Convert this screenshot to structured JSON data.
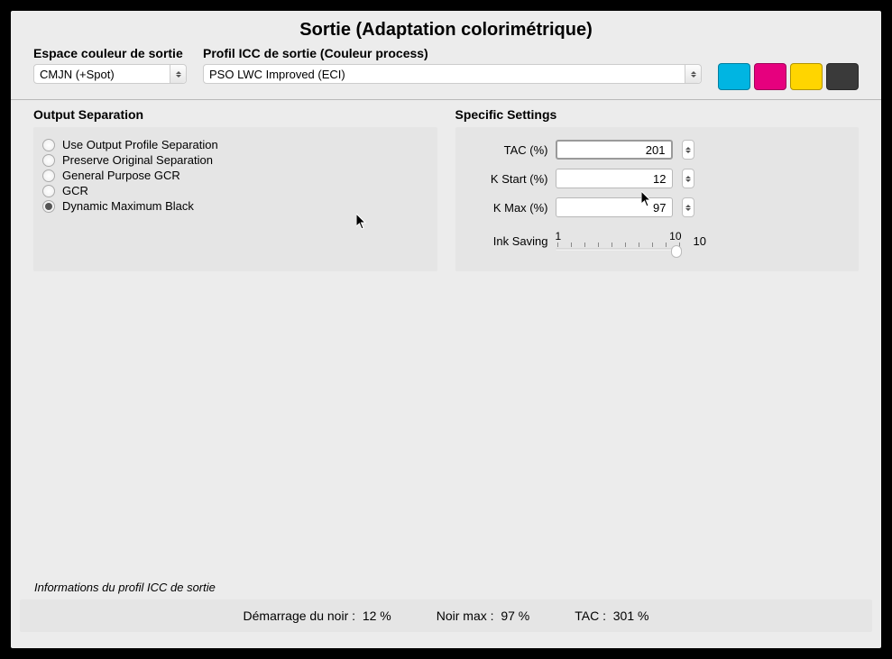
{
  "title": "Sortie (Adaptation colorimétrique)",
  "fields": {
    "ecs_label": "Espace couleur de sortie",
    "ecs_value": "CMJN (+Spot)",
    "icc_label": "Profil ICC de sortie (Couleur process)",
    "icc_value": "PSO LWC Improved (ECI)"
  },
  "swatches": {
    "cyan": "#00b5e2",
    "magenta": "#e6007e",
    "yellow": "#ffd500",
    "black": "#3a3a3a"
  },
  "output_separation": {
    "title": "Output Separation",
    "options": [
      "Use Output Profile Separation",
      "Preserve Original Separation",
      "General Purpose GCR",
      "GCR",
      "Dynamic Maximum Black"
    ],
    "selected": 4
  },
  "specific_settings": {
    "title": "Specific Settings",
    "tac_label": "TAC (%)",
    "tac_value": "201",
    "kstart_label": "K Start (%)",
    "kstart_value": "12",
    "kmax_label": "K Max (%)",
    "kmax_value": "97",
    "ink_label": "Ink Saving",
    "slider_min": "1",
    "slider_max": "10",
    "slider_value": "10"
  },
  "info": {
    "title": "Informations du profil ICC de sortie",
    "dnoir_label": "Démarrage du noir :",
    "dnoir_val": "12  %",
    "nmax_label": "Noir max :",
    "nmax_val": "97  %",
    "tac_label": "TAC :",
    "tac_val": "301  %"
  }
}
